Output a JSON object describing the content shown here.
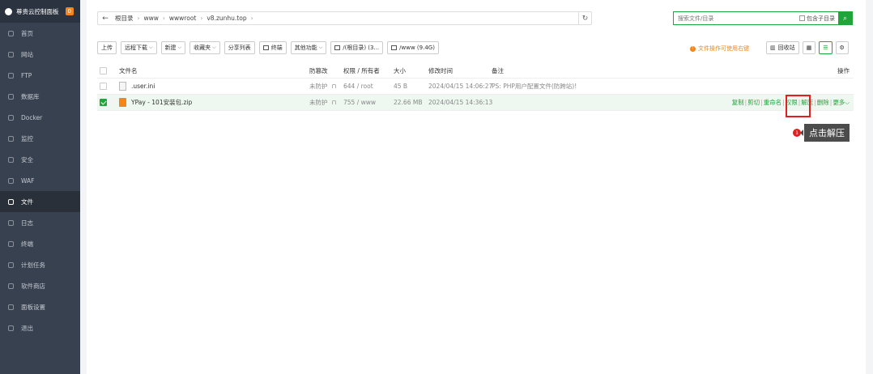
{
  "sidebar": {
    "brand": "尊贵云控制面板",
    "badge": "0",
    "items": [
      {
        "label": "首页",
        "icon": "home-icon",
        "active": false
      },
      {
        "label": "网站",
        "icon": "globe-icon",
        "active": false
      },
      {
        "label": "FTP",
        "icon": "ftp-icon",
        "active": false
      },
      {
        "label": "数据库",
        "icon": "database-icon",
        "active": false
      },
      {
        "label": "Docker",
        "icon": "docker-icon",
        "active": false
      },
      {
        "label": "监控",
        "icon": "monitor-icon",
        "active": false
      },
      {
        "label": "安全",
        "icon": "shield-icon",
        "active": false
      },
      {
        "label": "WAF",
        "icon": "waf-icon",
        "active": false
      },
      {
        "label": "文件",
        "icon": "folder-icon",
        "active": true
      },
      {
        "label": "日志",
        "icon": "log-icon",
        "active": false
      },
      {
        "label": "终端",
        "icon": "terminal-icon",
        "active": false
      },
      {
        "label": "计划任务",
        "icon": "calendar-icon",
        "active": false
      },
      {
        "label": "软件商店",
        "icon": "store-icon",
        "active": false
      },
      {
        "label": "面板设置",
        "icon": "settings-icon",
        "active": false
      },
      {
        "label": "退出",
        "icon": "logout-icon",
        "active": false
      }
    ]
  },
  "path": {
    "crumbs": [
      "根目录",
      "www",
      "wwwroot",
      "v8.zunhu.top"
    ]
  },
  "search": {
    "placeholder": "搜索文件/目录",
    "subdir_label": "包含子目录"
  },
  "toolbar": {
    "upload": "上传",
    "remote_download": "远程下载",
    "new": "新建",
    "favorites": "收藏夹",
    "share_list": "分享列表",
    "terminal": "终端",
    "more": "其他功能",
    "disk1": "/(根目录) (3...",
    "disk2": "/www (9.4G)"
  },
  "tip": "文件操作可使用右键",
  "rtools": {
    "recycle": "回收站"
  },
  "table": {
    "headers": {
      "name": "文件名",
      "protect": "防篡改",
      "perm": "权限 / 所有者",
      "size": "大小",
      "mtime": "修改时间",
      "note": "备注",
      "ops": "操作"
    },
    "rows": [
      {
        "name": ".user.ini",
        "protect": "未防护",
        "perm": "644 / root",
        "size": "45 B",
        "mtime": "2024/04/15 14:06:27",
        "note": "PS: PHP用户配置文件(防跨站)!",
        "selected": false
      },
      {
        "name": "YPay - 101安装包.zip",
        "protect": "未防护",
        "perm": "755 / www",
        "size": "22.66 MB",
        "mtime": "2024/04/15 14:36:13",
        "note": "",
        "selected": true
      }
    ],
    "ops": {
      "copy": "复制",
      "cut": "剪切",
      "rename": "重命名",
      "perm": "权限",
      "unzip": "解压",
      "delete": "删除",
      "more": "更多"
    }
  },
  "callout": {
    "num": "1",
    "text": "点击解压"
  },
  "colors": {
    "accent": "#20a53a",
    "sidebar": "#384150",
    "warn": "#f0861c",
    "highlight": "#e02020"
  }
}
